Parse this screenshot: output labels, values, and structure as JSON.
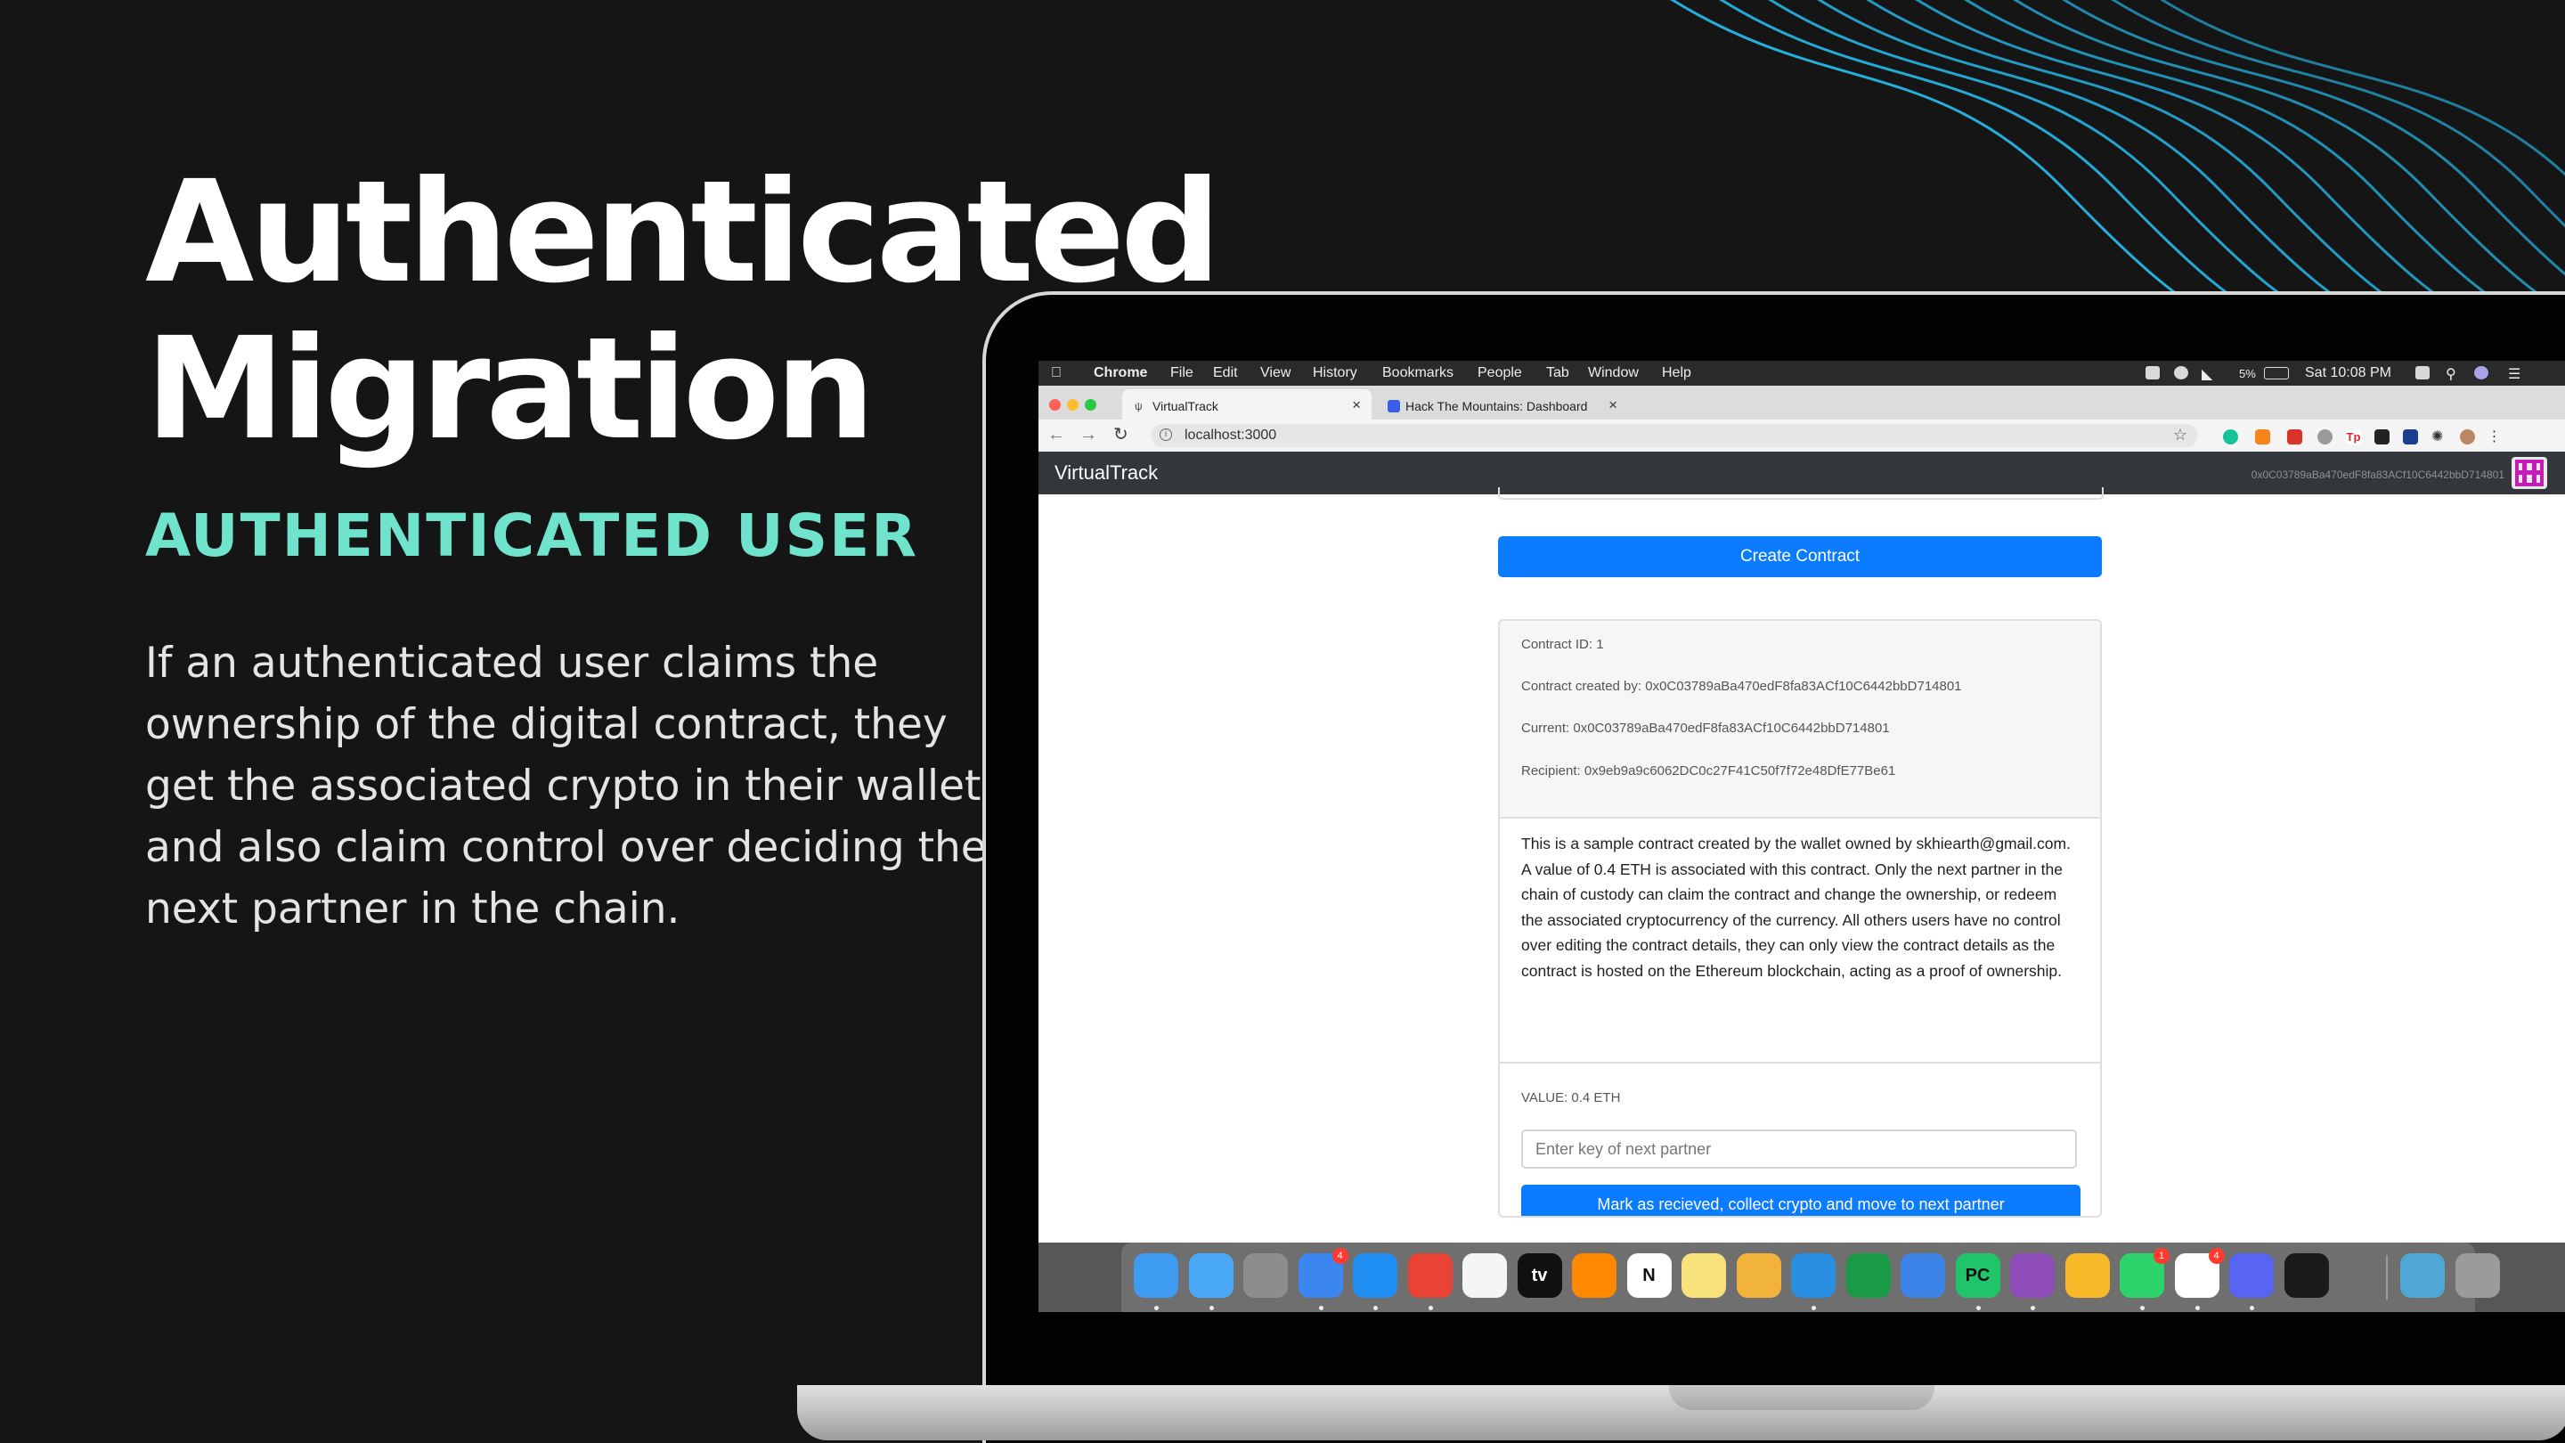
{
  "slide": {
    "title_line1": "Authenticated",
    "title_line2": "Migration",
    "subtitle": "AUTHENTICATED USER",
    "description": "If an authenticated user claims the ownership of the digital contract, they get the associated crypto in their wallet and also claim control over deciding the next partner in the chain.",
    "accent_color": "#6fe3cb",
    "wave_color": "#25b7e8"
  },
  "menubar": {
    "app_name": "Chrome",
    "items": [
      "File",
      "Edit",
      "View",
      "History",
      "Bookmarks",
      "People",
      "Tab",
      "Window",
      "Help"
    ],
    "battery": "5%",
    "clock": "Sat 10:08 PM"
  },
  "browser": {
    "tabs": [
      {
        "title": "VirtualTrack",
        "active": true
      },
      {
        "title": "Hack The Mountains: Dashboard",
        "active": false
      }
    ],
    "url": "localhost:3000"
  },
  "app": {
    "brand": "VirtualTrack",
    "account": "0x0C03789aBa470edF8fa83ACf10C6442bbD714801",
    "create_button": "Create Contract",
    "contract": {
      "id_line": "Contract ID: 1",
      "created_by": "Contract created by: 0x0C03789aBa470edF8fa83ACf10C6442bbD714801",
      "current": "Current: 0x0C03789aBa470edF8fa83ACf10C6442bbD714801",
      "recipient": "Recipient: 0x9eb9a9c6062DC0c27F41C50f7f72e48DfE77Be61",
      "description": "This is a sample contract created by the wallet owned by skhiearth@gmail.com. A value of 0.4 ETH is associated with this contract. Only the next partner in the chain of custody can claim the contract and change the ownership, or redeem the associated cryptocurrency of the currency. All others users have no control over editing the contract details, they can only view the contract details as the contract is hosted on the Ethereum blockchain, acting as a proof of ownership.",
      "value": "VALUE: 0.4 ETH",
      "partner_placeholder": "Enter key of next partner",
      "mark_button": "Mark as recieved, collect crypto and move to next partner"
    }
  },
  "dock": {
    "apps": [
      {
        "name": "Finder",
        "color": "#3d9bf0",
        "running": true
      },
      {
        "name": "Messages",
        "color": "#4aa8f8",
        "running": true
      },
      {
        "name": "Launchpad",
        "color": "#8d8d8d",
        "running": false
      },
      {
        "name": "Testflight",
        "color": "#3b86ef",
        "running": true,
        "badge": "4"
      },
      {
        "name": "Safari",
        "color": "#1e8ef2",
        "running": true
      },
      {
        "name": "Chrome",
        "color": "#e94335",
        "running": true
      },
      {
        "name": "Music",
        "color": "#f5f5f7",
        "running": false
      },
      {
        "name": "Apple TV",
        "color": "#111111",
        "running": false,
        "label": "tv"
      },
      {
        "name": "VLC",
        "color": "#ff8800",
        "running": false
      },
      {
        "name": "Notion",
        "color": "#ffffff",
        "running": false,
        "label": "N"
      },
      {
        "name": "Notes",
        "color": "#f7e27b",
        "running": false
      },
      {
        "name": "Pages",
        "color": "#f2b33d",
        "running": false
      },
      {
        "name": "VS Code",
        "color": "#2a8ee0",
        "running": true
      },
      {
        "name": "Git Client",
        "color": "#1a9a47",
        "running": false
      },
      {
        "name": "Xcode",
        "color": "#3d84e8",
        "running": false
      },
      {
        "name": "PyCharm",
        "color": "#20c46a",
        "running": true,
        "label": "PC"
      },
      {
        "name": "GitHub Desktop",
        "color": "#8e4cb9",
        "running": true
      },
      {
        "name": "Sketch",
        "color": "#f7b928",
        "running": false
      },
      {
        "name": "WhatsApp",
        "color": "#2cd46b",
        "running": true,
        "badge": "1"
      },
      {
        "name": "Slack",
        "color": "#ffffff",
        "running": true,
        "badge": "4"
      },
      {
        "name": "Discord",
        "color": "#5865f2",
        "running": true
      },
      {
        "name": "Terminal",
        "color": "#1a1a1a",
        "running": false
      }
    ],
    "extras": [
      {
        "name": "Downloads",
        "color": "#4fa7d5"
      },
      {
        "name": "Trash",
        "color": "#9b9b9b"
      }
    ]
  }
}
